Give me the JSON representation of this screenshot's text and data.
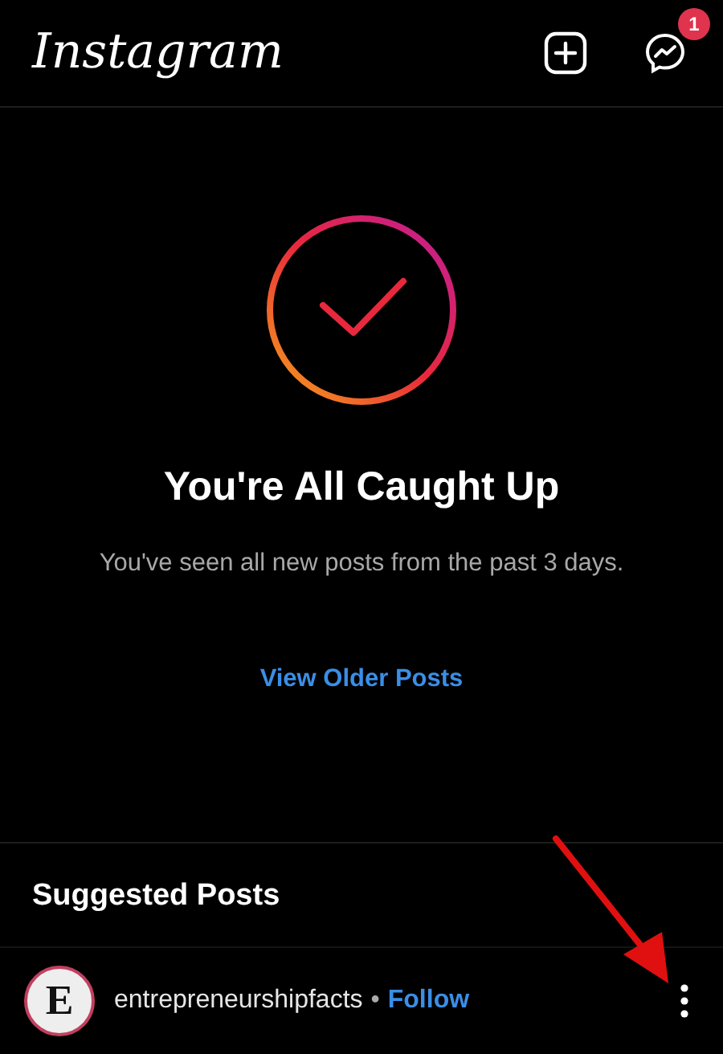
{
  "header": {
    "logo": "Instagram",
    "messages_badge": "1"
  },
  "caught_up": {
    "title": "You're All Caught Up",
    "subtitle": "You've seen all new posts from the past 3 days.",
    "link": "View Older Posts"
  },
  "suggested": {
    "title": "Suggested Posts"
  },
  "post": {
    "avatar_letter": "E",
    "username": "entrepreneurshipfacts",
    "separator": "•",
    "follow": "Follow"
  }
}
